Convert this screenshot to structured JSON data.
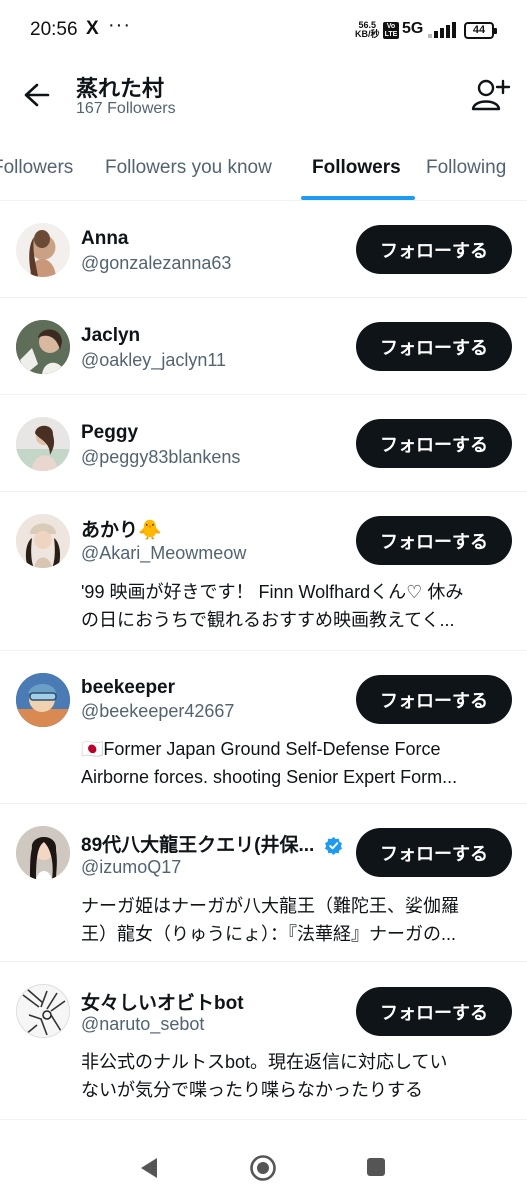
{
  "status_bar": {
    "time": "20:56",
    "app_icon": "X",
    "dots": "···",
    "speed_value": "56.5",
    "speed_unit": "KB/秒",
    "volte": "Vo LTE",
    "network": "5G",
    "battery": "44"
  },
  "header": {
    "back_icon": "arrow-left-icon",
    "title": "蒸れた村",
    "subtitle": "167 Followers",
    "add_user_icon": "add-user-icon"
  },
  "tabs": [
    {
      "label": "Followers",
      "active": false
    },
    {
      "label": "Followers you know",
      "active": false
    },
    {
      "label": "Followers",
      "active": true
    },
    {
      "label": "Following",
      "active": false
    }
  ],
  "follow_button_label": "フォローする",
  "users": [
    {
      "name": "Anna",
      "handle": "@gonzalezanna63",
      "bio": []
    },
    {
      "name": "Jaclyn",
      "handle": "@oakley_jaclyn11",
      "bio": []
    },
    {
      "name": "Peggy",
      "handle": "@peggy83blankens",
      "bio": []
    },
    {
      "name": "あかり🐥",
      "handle": "@Akari_Meowmeow",
      "bio": [
        "'99 映画が好きです！ Finn Wolfhardくん♡ 休み",
        "の日におうちで観れるおすすめ映画教えてく..."
      ]
    },
    {
      "name": "beekeeper",
      "handle": "@beekeeper42667",
      "bio": [
        "🇯🇵Former Japan Ground Self-Defense Force",
        "Airborne forces. shooting Senior Expert Form..."
      ]
    },
    {
      "name": "89代八大龍王クエリ(井保...",
      "handle": "@izumoQ17",
      "verified": true,
      "bio": [
        "ナーガ姫はナーガが八大龍王（難陀王、娑伽羅",
        "王）龍女（りゅうにょ）：『法華経』ナーガの..."
      ]
    },
    {
      "name": "女々しいオビトbot",
      "handle": "@naruto_sebot",
      "bio": [
        "非公式のナルトスbot。現在返信に対応してい",
        "ないが気分で喋ったり喋らなかったりする"
      ]
    }
  ],
  "colors": {
    "accent": "#1d9bf0",
    "text_primary": "#0f1419",
    "text_secondary": "#536471",
    "button_bg": "#0f1419"
  },
  "nav": {
    "back_icon": "nav-back-icon",
    "home_icon": "nav-home-icon",
    "recents_icon": "nav-recents-icon"
  }
}
